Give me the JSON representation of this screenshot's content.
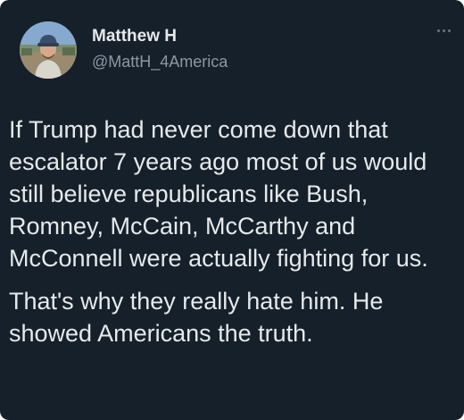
{
  "tweet": {
    "author": {
      "display_name": "Matthew H",
      "handle": "@MattH_4America"
    },
    "more_icon": "more-horizontal-icon",
    "paragraphs": [
      "If Trump had never come down that escalator 7 years ago most of us would still believe republicans like Bush, Romney, McCain, McCarthy and McConnell were actually fighting for us.",
      "That's why they really hate him. He showed Americans the truth."
    ]
  },
  "colors": {
    "background": "#15202b",
    "primary_text": "#e7e9ea",
    "secondary_text": "#8b98a5"
  }
}
